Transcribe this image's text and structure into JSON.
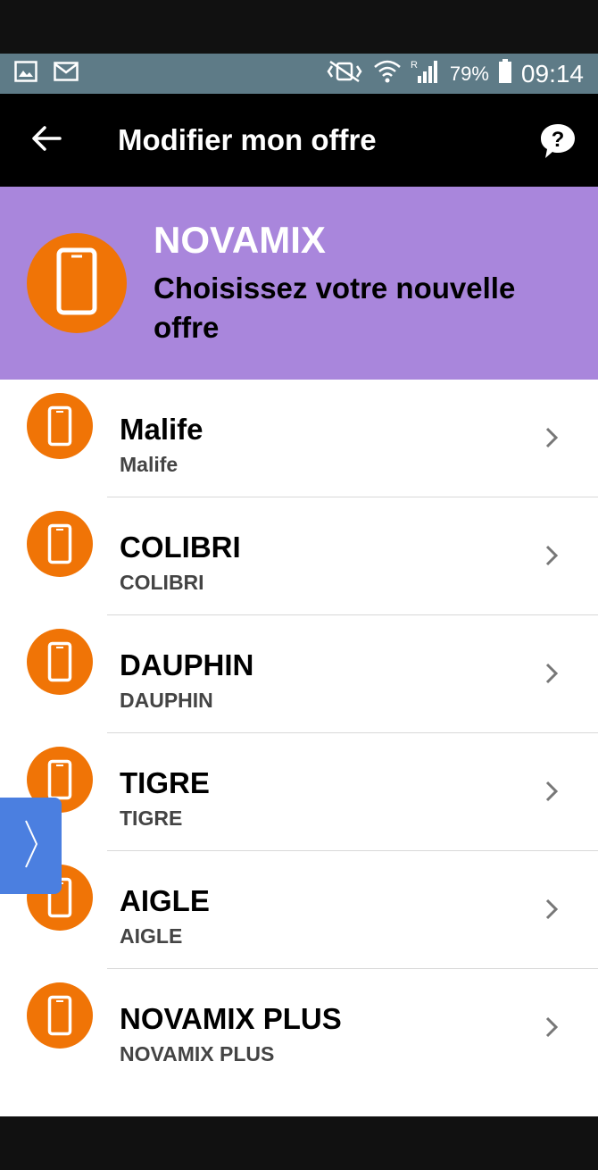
{
  "status_bar": {
    "battery": "79%",
    "time": "09:14",
    "network": "R",
    "icons": [
      "image-icon",
      "mail-icon",
      "mute-vibrate-icon",
      "wifi-icon",
      "signal-icon",
      "battery-icon"
    ]
  },
  "app_bar": {
    "title": "Modifier mon offre",
    "back_icon": "arrow-left-icon",
    "help_icon": "help-bubble-icon"
  },
  "header": {
    "title": "NOVAMIX",
    "subtitle": "Choisissez votre nouvelle offre",
    "icon": "phone-icon"
  },
  "offers": [
    {
      "title": "Malife",
      "subtitle": "Malife"
    },
    {
      "title": "COLIBRI",
      "subtitle": "COLIBRI"
    },
    {
      "title": "DAUPHIN",
      "subtitle": "DAUPHIN"
    },
    {
      "title": "TIGRE",
      "subtitle": "TIGRE"
    },
    {
      "title": "AIGLE",
      "subtitle": "AIGLE"
    },
    {
      "title": "NOVAMIX PLUS",
      "subtitle": "NOVAMIX PLUS"
    }
  ],
  "colors": {
    "status_bar": "#5e7b87",
    "app_bar": "#000000",
    "header_bg": "#a986dc",
    "accent_orange": "#f07406",
    "side_tab": "#4b7fe0"
  }
}
